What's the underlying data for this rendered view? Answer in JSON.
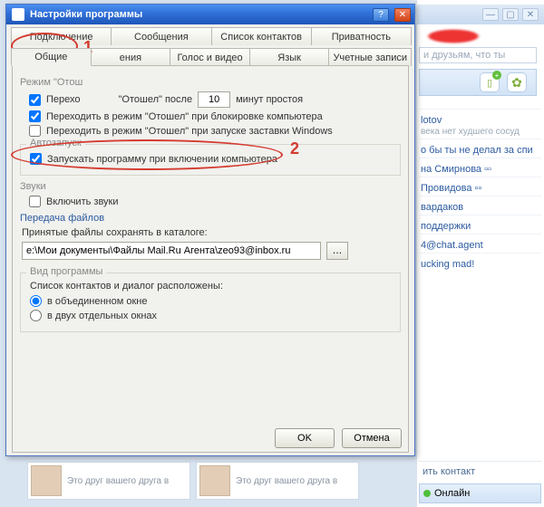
{
  "bg": {
    "search_placeholder": "и друзьям, что ты",
    "contacts": [
      {
        "name": "lotov",
        "sub": "века нет худшего сосуд"
      },
      {
        "name": "о бы ты не делал за спи",
        "sub": ""
      },
      {
        "name": "на Смирнова ▫▫",
        "sub": ""
      },
      {
        "name": "Провидова ▫▫",
        "sub": ""
      },
      {
        "name": "вардаков",
        "sub": ""
      },
      {
        "name": "поддержки",
        "sub": ""
      },
      {
        "name": "4@chat.agent",
        "sub": ""
      },
      {
        "name": "ucking mad!",
        "sub": ""
      }
    ],
    "add_contact": "ить контакт",
    "status": "Онлайн"
  },
  "thumbs": [
    {
      "t": "Это друг вашего друга в"
    },
    {
      "t": "Это друг вашего друга в"
    }
  ],
  "dlg": {
    "title": "Настройки программы",
    "tabs_row1": [
      "Подключение",
      "Сообщения",
      "Список контактов",
      "Приватность"
    ],
    "tabs_row2": [
      "Общие",
      "ения",
      "Голос и видео",
      "Язык",
      "Учетные записи"
    ],
    "active_tab": "Общие",
    "away": {
      "title": "Режим \"Отош",
      "chk1": "Перехо",
      "chk1_after": "\"Отошел\" после",
      "minutes": "10",
      "chk1_tail": "минут простоя",
      "chk2": "Переходить в режим \"Отошел\" при блокировке компьютера",
      "chk3": "Переходить в режим \"Отошел\" при запуске заставки Windows"
    },
    "autorun": {
      "title": "Автозапуск",
      "chk": "Запускать программу при включении компьютера"
    },
    "sounds": {
      "title": "Звуки",
      "chk": "Включить звуки"
    },
    "files": {
      "title": "Передача файлов",
      "label": "Принятые файлы сохранять в каталоге:",
      "path": "e:\\Мои документы\\Файлы Mail.Ru Агента\\zeo93@inbox.ru"
    },
    "view": {
      "title": "Вид программы",
      "label": "Список контактов и диалог расположены:",
      "opt1": "в объединенном окне",
      "opt2": "в двух отдельных окнах"
    },
    "ok": "OK",
    "cancel": "Отмена"
  },
  "anno": {
    "n1": "1",
    "n2": "2"
  }
}
